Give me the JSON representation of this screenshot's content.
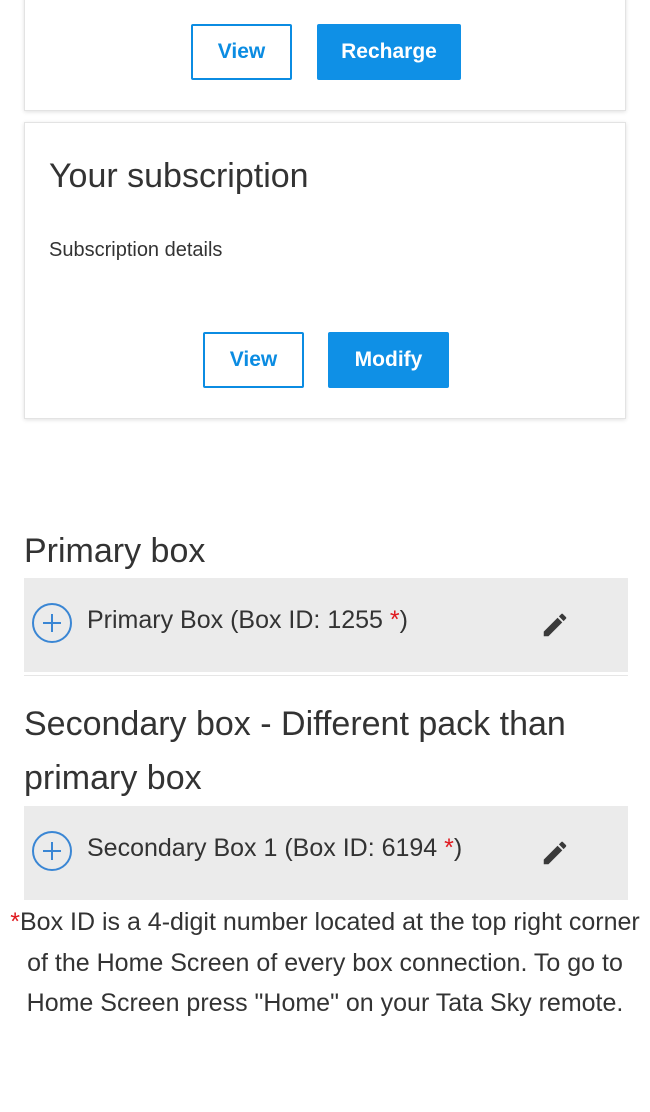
{
  "balance_card": {
    "view_label": "View",
    "recharge_label": "Recharge"
  },
  "subscription_card": {
    "title": "Your subscription",
    "subtitle": "Subscription details",
    "view_label": "View",
    "modify_label": "Modify"
  },
  "primary_section": {
    "title": "Primary box",
    "box_label": "Primary Box (Box ID: 1255 ",
    "asterisk": "*",
    "close_paren": ")"
  },
  "secondary_section": {
    "title_line1": "Secondary box - Different pack than",
    "title_line2": "primary box",
    "box_label": "Secondary Box 1 (Box ID: 6194 ",
    "asterisk": "*",
    "close_paren": ")"
  },
  "footnote": {
    "asterisk": "*",
    "text": "Box ID is a 4-digit number located at the top right corner of the Home Screen of every box connection. To go to Home Screen press \"Home\" on your Tata Sky remote."
  },
  "icons": {
    "expand": "plus-circle-icon",
    "edit": "pencil-icon"
  },
  "colors": {
    "accent_blue": "#0f90e6",
    "asterisk_red": "#e0191f",
    "row_background": "#ebebeb"
  }
}
